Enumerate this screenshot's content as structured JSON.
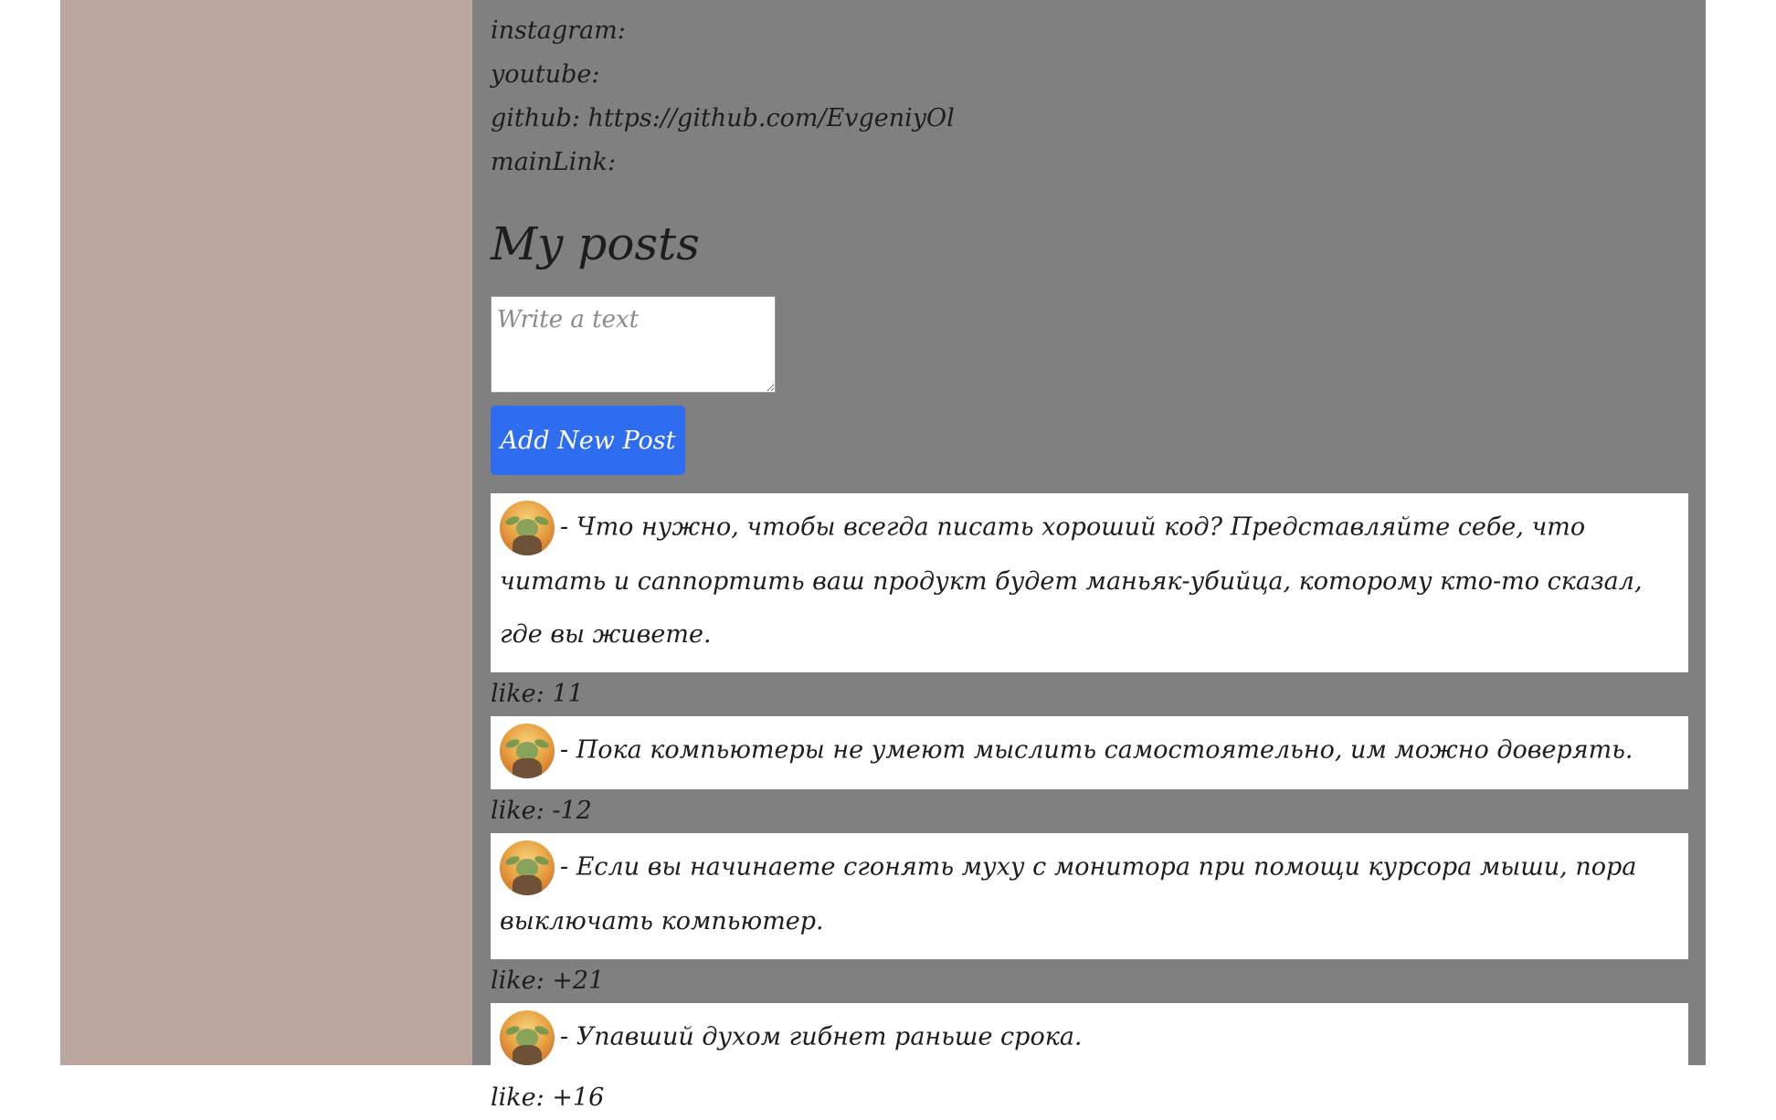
{
  "profile": {
    "links": [
      {
        "label": "instagram:",
        "value": ""
      },
      {
        "label": "youtube:",
        "value": ""
      },
      {
        "label": "github:",
        "value": "https://github.com/EvgeniyOl"
      },
      {
        "label": "mainLink:",
        "value": ""
      }
    ]
  },
  "posts_section": {
    "title": "My posts",
    "input_placeholder": "Write a text",
    "add_button_label": "Add New Post",
    "like_prefix": "like:",
    "items": [
      {
        "text": "- Что нужно, чтобы всегда писать хороший код? Представляйте себе, что читать и саппортить ваш продукт будет маньяк-убийца, которому кто-то сказал, где вы живете.",
        "likes": "11"
      },
      {
        "text": "- Пока компьютеры не умеют мыслить самостоятельно, им можно доверять.",
        "likes": "-12"
      },
      {
        "text": "- Если вы начинаете сгонять муху с монитора при помощи курсора мыши, пора выключать компьютер.",
        "likes": "+21"
      },
      {
        "text": "- Упавший духом гибнет раньше срока.",
        "likes": "+16"
      }
    ]
  },
  "colors": {
    "sidebar_bg": "#bca6a0",
    "content_bg": "#808080",
    "button_bg": "#2f6df0"
  }
}
